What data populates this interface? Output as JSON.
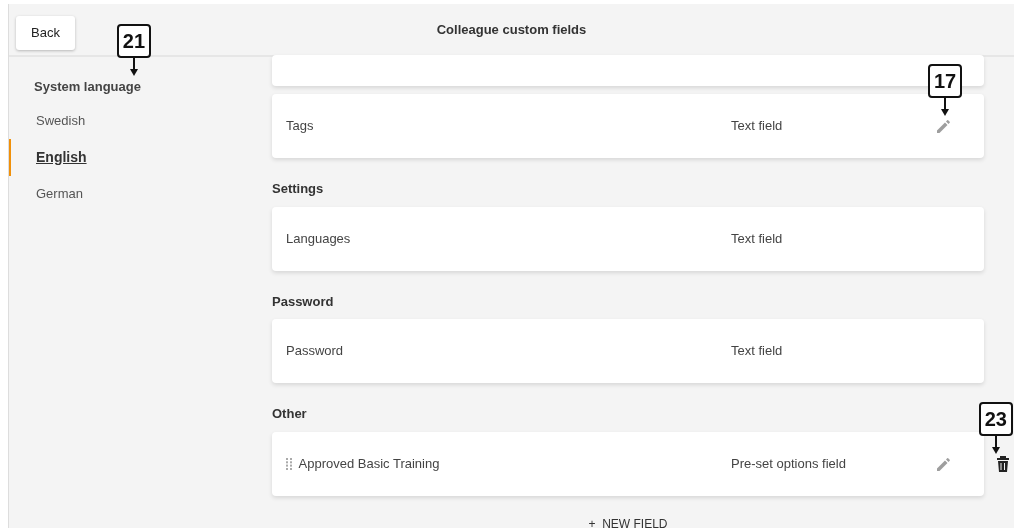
{
  "header": {
    "back_button": "Back",
    "title": "Colleague custom fields"
  },
  "sidebar": {
    "heading": "System language",
    "callout": "21",
    "items": [
      {
        "label": "Swedish",
        "selected": false
      },
      {
        "label": "English",
        "selected": true
      },
      {
        "label": "German",
        "selected": false
      }
    ]
  },
  "sections": [
    {
      "rows": [
        {
          "clipped": true,
          "drag_handle": false,
          "edit_icon": false,
          "delete_icon": false
        },
        {
          "clipped": false,
          "name": "Tags",
          "type": "Text field",
          "drag_handle": false,
          "edit_icon": true,
          "delete_icon": false,
          "callout": "17"
        }
      ]
    },
    {
      "heading": "Settings",
      "rows": [
        {
          "clipped": false,
          "name": "Languages",
          "type": "Text field",
          "drag_handle": false,
          "edit_icon": false,
          "delete_icon": false
        }
      ]
    },
    {
      "heading": "Password",
      "rows": [
        {
          "clipped": false,
          "name": "Password",
          "type": "Text field",
          "drag_handle": false,
          "edit_icon": false,
          "delete_icon": false
        }
      ]
    },
    {
      "heading": "Other",
      "rows": [
        {
          "clipped": false,
          "name": "Approved Basic Training",
          "type": "Pre-set options field",
          "drag_handle": true,
          "edit_icon": true,
          "delete_icon": true,
          "callout": "23"
        }
      ]
    }
  ],
  "new_field_button": {
    "icon": "+",
    "label": "NEW FIELD"
  }
}
